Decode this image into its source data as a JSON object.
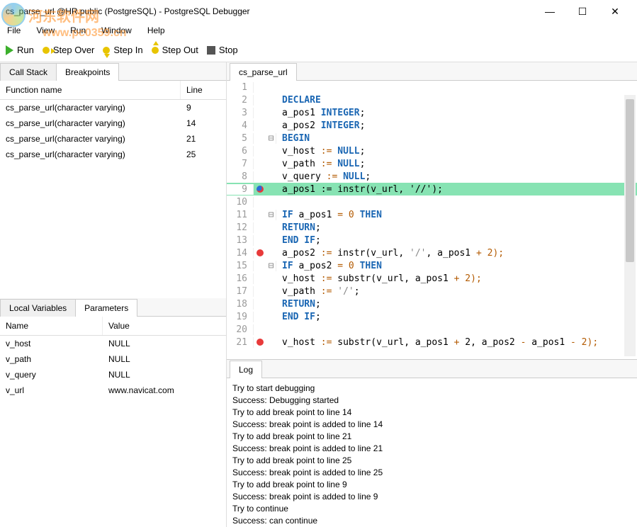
{
  "window": {
    "title": "cs_parse_url @HR.public (PostgreSQL) - PostgreSQL Debugger"
  },
  "watermark": {
    "text": "河东软件网",
    "url": "www.pc0359.cn"
  },
  "menu": {
    "file": "File",
    "view": "View",
    "run": "Run",
    "window": "Window",
    "help": "Help"
  },
  "toolbar": {
    "run": "Run",
    "step_over": "Step Over",
    "step_in": "Step In",
    "step_out": "Step Out",
    "stop": "Stop"
  },
  "left_tabs": {
    "call_stack": "Call Stack",
    "breakpoints": "Breakpoints"
  },
  "bp_headers": {
    "func": "Function name",
    "line": "Line"
  },
  "breakpoints": [
    {
      "func": "cs_parse_url(character varying)",
      "line": "9"
    },
    {
      "func": "cs_parse_url(character varying)",
      "line": "14"
    },
    {
      "func": "cs_parse_url(character varying)",
      "line": "21"
    },
    {
      "func": "cs_parse_url(character varying)",
      "line": "25"
    }
  ],
  "var_tabs": {
    "local": "Local Variables",
    "params": "Parameters"
  },
  "var_headers": {
    "name": "Name",
    "value": "Value"
  },
  "variables": [
    {
      "name": "v_host",
      "value": "NULL"
    },
    {
      "name": "v_path",
      "value": "NULL"
    },
    {
      "name": "v_query",
      "value": "NULL"
    },
    {
      "name": "v_url",
      "value": "www.navicat.com"
    }
  ],
  "code_tab": "cs_parse_url",
  "code": {
    "l1": " ",
    "l2_kw": "DECLARE",
    "l3_a": "    a_pos1 ",
    "l3_b": "INTEGER",
    "l3_c": ";",
    "l4_a": "    a_pos2 ",
    "l4_b": "INTEGER",
    "l4_c": ";",
    "l5_kw": "BEGIN",
    "l6_a": "    v_host ",
    "l6_op": ":=",
    "l6_b": " NULL",
    "l6_c": ";",
    "l7_a": "    v_path ",
    "l7_op": ":=",
    "l7_b": " NULL",
    "l7_c": ";",
    "l8_a": "    v_query ",
    "l8_op": ":=",
    "l8_b": " NULL",
    "l8_c": ";",
    "l9": "    a_pos1 := instr(v_url, '//');",
    "l10": " ",
    "l11_a": "    ",
    "l11_kw": "IF",
    "l11_b": " a_pos1 ",
    "l11_op": "=",
    "l11_c": " 0 ",
    "l11_kw2": "THEN",
    "l12_a": "        ",
    "l12_kw": "RETURN",
    "l12_b": ";",
    "l13_a": "    ",
    "l13_kw": "END IF",
    "l13_b": ";",
    "l14_a": "    a_pos2 ",
    "l14_op": ":=",
    "l14_b": " instr(v_url, ",
    "l14_s": "'/'",
    "l14_c": ", a_pos1 ",
    "l14_op2": "+",
    "l14_d": " 2);",
    "l15_a": "    ",
    "l15_kw": "IF",
    "l15_b": " a_pos2 ",
    "l15_op": "=",
    "l15_c": " 0 ",
    "l15_kw2": "THEN",
    "l16_a": "        v_host ",
    "l16_op": ":=",
    "l16_b": " substr(v_url, a_pos1 ",
    "l16_op2": "+",
    "l16_c": " 2);",
    "l17_a": "        v_path ",
    "l17_op": ":=",
    "l17_b": " ",
    "l17_s": "'/'",
    "l17_c": ";",
    "l18_a": "        ",
    "l18_kw": "RETURN",
    "l18_b": ";",
    "l19_a": "    ",
    "l19_kw": "END IF",
    "l19_b": ";",
    "l20": " ",
    "l21_a": "    v_host ",
    "l21_op": ":=",
    "l21_b": " substr(v_url, a_pos1 ",
    "l21_op2": "+",
    "l21_c": " 2, a_pos2 ",
    "l21_op3": "-",
    "l21_d": " a_pos1 ",
    "l21_op4": "-",
    "l21_e": " 2);"
  },
  "log_tab": "Log",
  "log": [
    "Try to start debugging",
    "Success: Debugging started",
    "Try to add break point to line 14",
    "Success: break point is added to line 14",
    "Try to add break point to line 21",
    "Success: break point is added to line 21",
    "Try to add break point to line 25",
    "Success: break point is added to line 25",
    "Try to add break point to line 9",
    "Success: break point is added to line 9",
    "Try to continue",
    "Success: can continue"
  ]
}
